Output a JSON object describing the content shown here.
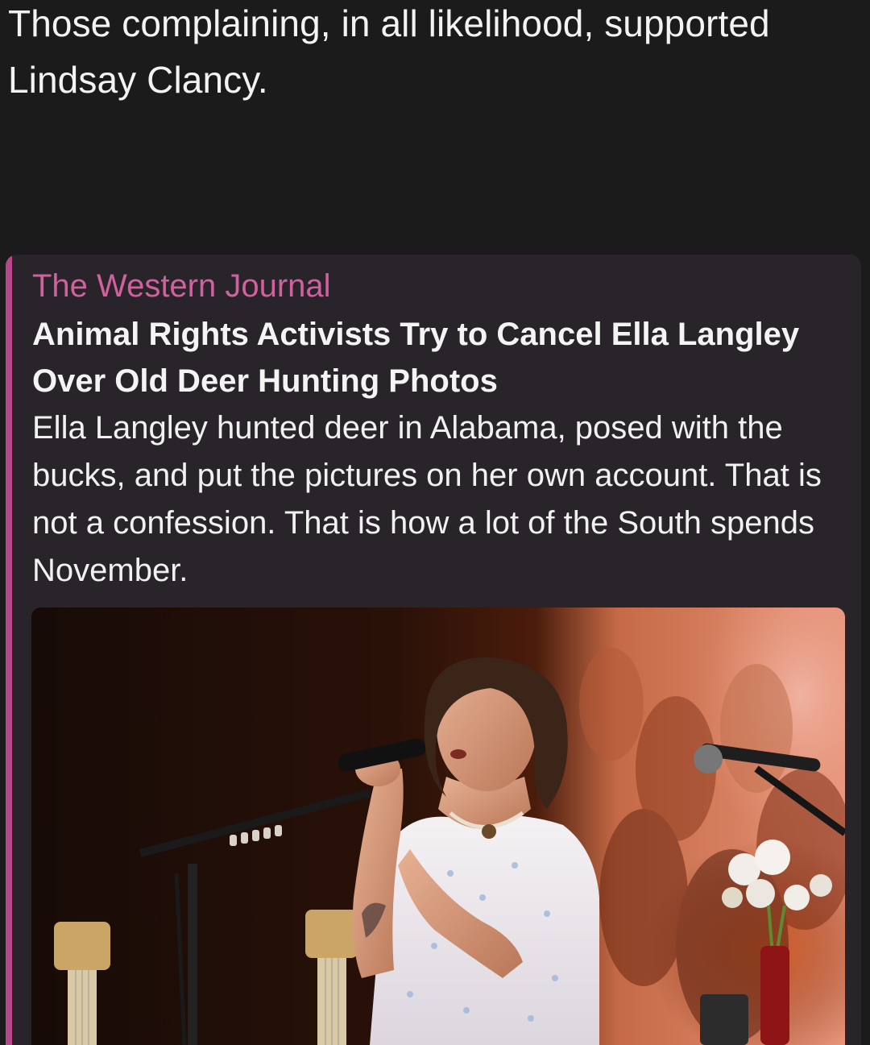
{
  "message": {
    "text": "Those complaining, in all likelihood, supported Lindsay Clancy."
  },
  "link_preview": {
    "site_name": "The Western Journal",
    "title": "Animal Rights Activists Try to Cancel Ella Langley Over Old Deer Hunting Photos",
    "description": "Ella Langley hunted deer in Alabama, posed with the bucks, and put the pictures on her own account. That is not a confession. That is how a lot of the South spends November.",
    "accent_color": "#b9478c",
    "site_name_color": "#d1609e",
    "card_background": "#29232a",
    "image_icon": "concert-photo"
  }
}
